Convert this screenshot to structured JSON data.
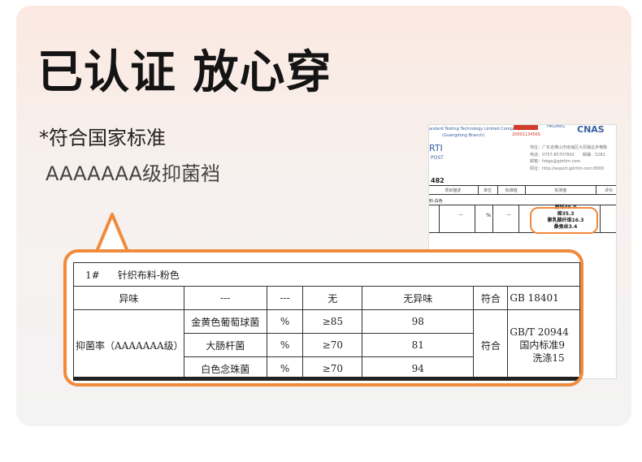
{
  "headline": "已认证 放心穿",
  "subline": "*符合国家标准",
  "grade": "AAAAAAA级抑菌裆",
  "report": {
    "company_line1": "andard Testing Technology Limited Company",
    "company_line2": "(Guangdong Branch)",
    "logo_text": "IIIA",
    "logo_num": "2000113456S",
    "logo2_text": "HKGMEG",
    "logo3_text": "CNAS",
    "mark": "RTI",
    "post": "POST",
    "address_lines": [
      "地址：广东省佛山市南海区大沥镇总步横路",
      "电话：0757-85707802　　邮编：5282",
      "邮箱：fsbgs@gdrtim.com",
      "网址：http://export.gdrtim.com:8000"
    ],
    "report_no": "482",
    "headers": [
      "项目描述",
      "单位",
      "标准值",
      "实测值",
      "评价"
    ],
    "section": "料-白色",
    "composition": [
      "棉纤45.0",
      "棉35.3",
      "聚乳酸纤维16.3",
      "桑蚕丝3.4"
    ],
    "dash": "—",
    "unit": "%"
  },
  "table": {
    "header_row": {
      "id": "1#",
      "name": "针织布料-粉色"
    },
    "odor_row": [
      "异味",
      "---",
      "---",
      "无",
      "无异味",
      "符合",
      "GB 18401"
    ],
    "antibac_label": "抑菌率（AAAAAAA级）",
    "antibac_rows": [
      {
        "organism": "金黄色葡萄球菌",
        "unit": "%",
        "standard": "≥85",
        "value": "98"
      },
      {
        "organism": "大肠杆菌",
        "unit": "%",
        "standard": "≥70",
        "value": "81"
      },
      {
        "organism": "白色念珠菌",
        "unit": "%",
        "standard": "≥70",
        "value": "94"
      }
    ],
    "antibac_result": "符合",
    "antibac_method": [
      "GB/T 20944",
      "国内标准9",
      "洗涤15"
    ]
  },
  "colors": {
    "accent": "#f08a3c",
    "text": "#141414",
    "background_top": "#fbe9e1"
  }
}
